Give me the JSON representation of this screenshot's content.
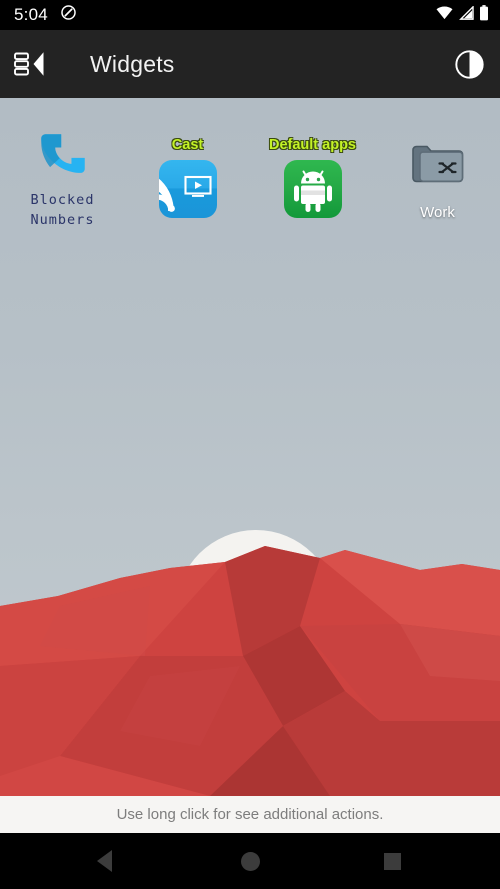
{
  "status_bar": {
    "clock": "5:04",
    "left_icons": [
      {
        "name": "do-not-disturb-icon",
        "glyph": "slash-circle"
      }
    ],
    "right_icons": [
      {
        "name": "wifi-icon",
        "glyph": "wifi"
      },
      {
        "name": "cellular-signal-icon",
        "glyph": "signal"
      },
      {
        "name": "battery-icon",
        "glyph": "battery-full"
      }
    ]
  },
  "app_bar": {
    "title": "Widgets",
    "up_icon": "list-back-icon",
    "action_icon": "contrast-icon"
  },
  "widgets": [
    {
      "id": "blocked-numbers",
      "label": "Blocked\nNumbers",
      "label_line1": "Blocked",
      "label_line2": "Numbers",
      "label_position": "below",
      "label_style": "mono-navy",
      "icon": "phone-handset-icon",
      "icon_color": "#29b6f6"
    },
    {
      "id": "cast",
      "label": "Cast",
      "label_position": "above",
      "label_style": "lime-outline",
      "icon": "cast-icon",
      "icon_color": "#2aa9e8"
    },
    {
      "id": "default-apps",
      "label": "Default apps",
      "label_position": "above",
      "label_style": "lime-outline",
      "icon": "android-robot-icon",
      "icon_color": "#24a845"
    },
    {
      "id": "work",
      "label": "Work",
      "label_position": "below",
      "label_style": "white",
      "icon": "work-folder-icon",
      "icon_color": "#7d8e9b"
    }
  ],
  "hint": {
    "text": "Use long click for see additional actions."
  },
  "nav_bar": {
    "back": "back-triangle-icon",
    "home": "home-circle-icon",
    "recents": "recents-square-icon"
  },
  "colors": {
    "status_bar_bg": "#000000",
    "app_bar_bg": "#232323",
    "app_bar_text": "#f2f2f2",
    "wallpaper_sky": "#b7c1c8",
    "wallpaper_mountain": "#cf4440",
    "wallpaper_sun": "#f4f3f0",
    "hint_bar_bg": "#f6f5f3",
    "hint_text": "#7d7d7d",
    "nav_icon": "#3c3c3c",
    "label_lime": "#c3f227",
    "label_navy": "#2b3569"
  }
}
